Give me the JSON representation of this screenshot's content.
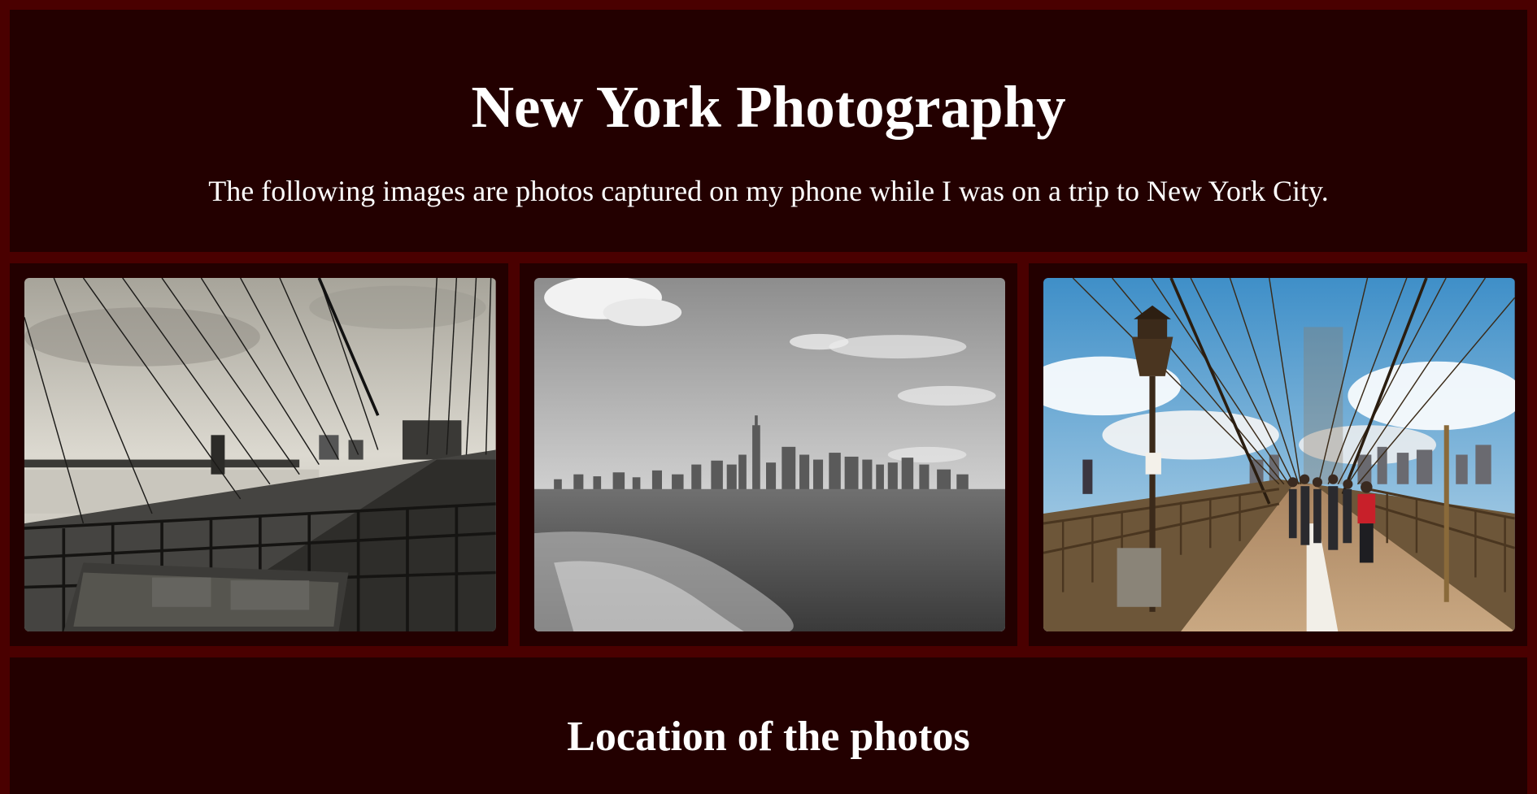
{
  "header": {
    "title": "New York Photography",
    "subtitle": "The following images are photos captured on my phone while I was on a trip to New York City."
  },
  "gallery": {
    "photos": [
      {
        "subject": "brooklyn-bridge-bw",
        "style": "black-and-white"
      },
      {
        "subject": "manhattan-skyline-from-water",
        "style": "black-and-white"
      },
      {
        "subject": "brooklyn-bridge-walkway",
        "style": "color"
      }
    ]
  },
  "location": {
    "heading": "Location of the photos"
  },
  "colors": {
    "page_background": "#4a0000",
    "panel_background": "#230000",
    "text": "#ffffff"
  }
}
